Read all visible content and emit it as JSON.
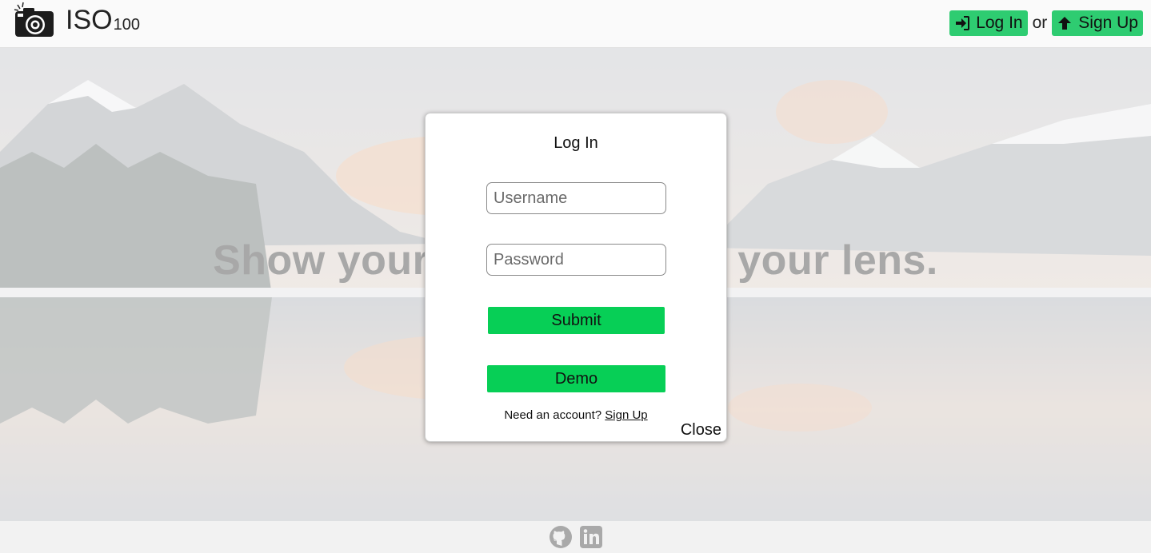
{
  "header": {
    "brand": "ISO",
    "brand_sub": "100",
    "login_label": "Log In",
    "or_text": "or",
    "signup_label": "Sign Up"
  },
  "hero": {
    "tagline": "Show your world through your lens."
  },
  "modal": {
    "title": "Log In",
    "username_placeholder": "Username",
    "password_placeholder": "Password",
    "submit_label": "Submit",
    "demo_label": "Demo",
    "need_account_text": "Need an account?",
    "signup_link": "Sign Up",
    "close_label": "Close"
  },
  "footer": {
    "icons": [
      "github-icon",
      "linkedin-icon"
    ]
  },
  "colors": {
    "accent_green": "#2ecc71",
    "button_green": "#07cf56"
  }
}
